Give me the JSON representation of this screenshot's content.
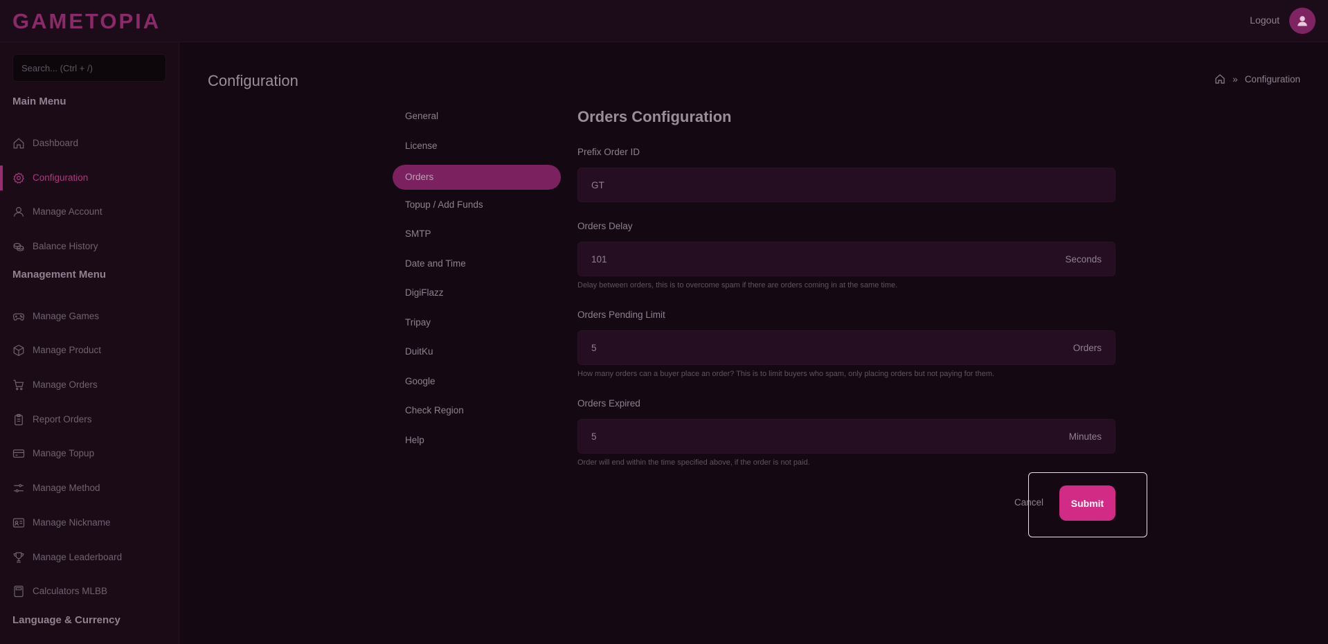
{
  "header": {
    "logo": "GAMETOPIA",
    "logout_label": "Logout",
    "avatar_icon": "user-icon"
  },
  "sidebar": {
    "search_placeholder": "Search... (Ctrl + /)",
    "main_menu_title": "Main Menu",
    "main_items": [
      {
        "label": "Dashboard",
        "icon": "home-icon"
      },
      {
        "label": "Configuration",
        "icon": "gear-icon",
        "active": true
      },
      {
        "label": "Manage Account",
        "icon": "user-icon"
      },
      {
        "label": "Balance History",
        "icon": "coins-icon"
      }
    ],
    "management_menu_title": "Management Menu",
    "management_items": [
      {
        "label": "Manage Games",
        "icon": "gamepad-icon"
      },
      {
        "label": "Manage Product",
        "icon": "box-icon"
      },
      {
        "label": "Manage Orders",
        "icon": "cart-icon"
      },
      {
        "label": "Report Orders",
        "icon": "clipboard-icon"
      },
      {
        "label": "Manage Topup",
        "icon": "card-icon"
      },
      {
        "label": "Manage Method",
        "icon": "sliders-icon"
      },
      {
        "label": "Manage Nickname",
        "icon": "id-card-icon"
      },
      {
        "label": "Manage Leaderboard",
        "icon": "trophy-icon"
      },
      {
        "label": "Calculators MLBB",
        "icon": "calculator-icon"
      }
    ],
    "language_menu_title": "Language & Currency"
  },
  "page": {
    "title": "Configuration",
    "breadcrumb_current": "Configuration"
  },
  "tabs": [
    {
      "label": "General"
    },
    {
      "label": "License"
    },
    {
      "label": "Orders",
      "active": true
    },
    {
      "label": "Topup / Add Funds"
    },
    {
      "label": "SMTP"
    },
    {
      "label": "Date and Time"
    },
    {
      "label": "DigiFlazz"
    },
    {
      "label": "Tripay"
    },
    {
      "label": "DuitKu"
    },
    {
      "label": "Google"
    },
    {
      "label": "Check Region"
    },
    {
      "label": "Help"
    }
  ],
  "form": {
    "title": "Orders Configuration",
    "fields": [
      {
        "label": "Prefix Order ID",
        "value": "GT",
        "suffix": "",
        "hint": ""
      },
      {
        "label": "Orders Delay",
        "value": "101",
        "suffix": "Seconds",
        "hint": "Delay between orders, this is to overcome spam if there are orders coming in at the same time."
      },
      {
        "label": "Orders Pending Limit",
        "value": "5",
        "suffix": "Orders",
        "hint": "How many orders can a buyer place an order? This is to limit buyers who spam, only placing orders but not paying for them."
      },
      {
        "label": "Orders Expired",
        "value": "5",
        "suffix": "Minutes",
        "hint": "Order will end within the time specified above, if the order is not paid."
      }
    ],
    "cancel_label": "Cancel",
    "submit_label": "Submit"
  },
  "colors": {
    "background": "#140812",
    "accent": "#d12b86",
    "active_tab": "#7b2160",
    "input_bg": "#260e22"
  }
}
